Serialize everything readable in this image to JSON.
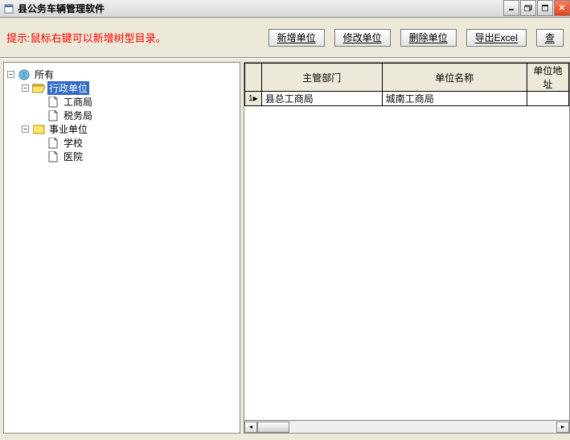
{
  "window": {
    "title": "县公务车辆管理软件"
  },
  "toolbar": {
    "hint": "提示:鼠标右键可以新增树型目录。",
    "buttons": {
      "add": "新增单位",
      "edit": "修改单位",
      "del": "删除单位",
      "export": "导出Excel",
      "search": "查"
    }
  },
  "tree": {
    "root": "所有",
    "branch1": {
      "label": "行政单位",
      "child1": "工商局",
      "child2": "税务局"
    },
    "branch2": {
      "label": "事业单位",
      "child1": "学校",
      "child2": "医院"
    }
  },
  "grid": {
    "columns": {
      "dept": "主管部门",
      "name": "单位名称",
      "addr": "单位地址"
    },
    "rows": [
      {
        "dept": "县总工商局",
        "name": "城南工商局",
        "addr": ""
      }
    ]
  },
  "glyphs": {
    "minus": "−",
    "plus": "+",
    "arrow": "▶"
  }
}
